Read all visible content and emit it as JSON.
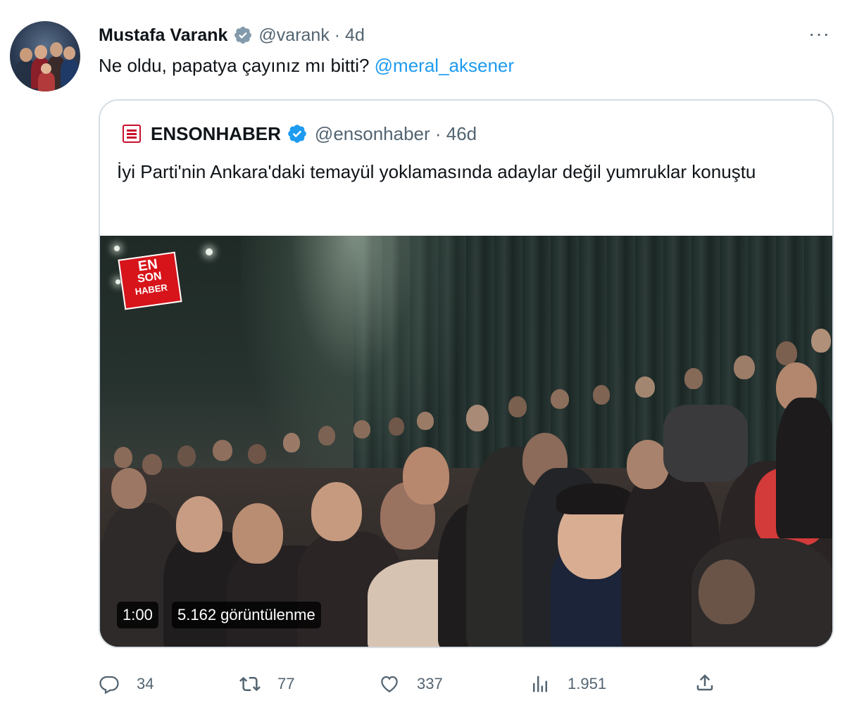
{
  "tweet": {
    "author_name": "Mustafa Varank",
    "author_handle": "@varank · 4d",
    "text_before": "Ne oldu, papatya çayınız mı bitti? ",
    "mention": "@meral_aksener",
    "more_label": "···"
  },
  "quote": {
    "author_name": "ENSONHABER",
    "author_handle": "@ensonhaber · 46d",
    "text": "İyi Parti'nin Ankara'daki temayül yoklamasında adaylar değil yumruklar konuştu",
    "video": {
      "logo_line1": "EN",
      "logo_line2": "SON",
      "logo_line3": "HABER",
      "duration": "1:00",
      "views": "5.162 görüntülenme"
    }
  },
  "actions": {
    "replies": "34",
    "retweets": "77",
    "likes": "337",
    "views": "1.951"
  },
  "colors": {
    "link": "#1d9bf0",
    "verified_blue": "#1d9bf0",
    "verified_gray": "#829aab",
    "secondary_text": "#536471",
    "border": "#d6dde2"
  },
  "icons": [
    "verified-gray-icon",
    "verified-blue-icon",
    "more-icon",
    "reply-icon",
    "retweet-icon",
    "like-icon",
    "views-icon",
    "share-icon"
  ]
}
